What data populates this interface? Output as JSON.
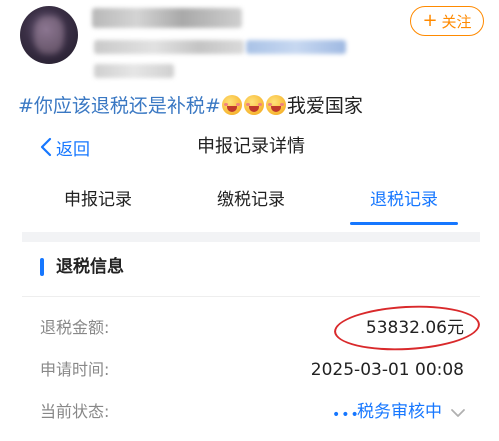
{
  "post": {
    "follow_label": "关注",
    "follow_icon": "plus-icon",
    "hashtag": "#你应该退税还是补税#",
    "emoji_name": "face-blowing-kiss-emoji",
    "emoji_count": 3,
    "tail_text": "我爱国家"
  },
  "screen": {
    "back_label": "返回",
    "title": "申报记录详情",
    "tabs": [
      {
        "label": "申报记录",
        "active": false
      },
      {
        "label": "缴税记录",
        "active": false
      },
      {
        "label": "退税记录",
        "active": true
      }
    ],
    "section_title": "退税信息",
    "rows": [
      {
        "label": "退税金额:",
        "value": "53832.06元"
      },
      {
        "label": "申请时间:",
        "value": "2025-03-01 00:08"
      },
      {
        "label": "当前状态:",
        "value": "税务审核中"
      }
    ],
    "colors": {
      "accent": "#1677ff",
      "follow": "#ff8a00",
      "hashtag": "#3a78c3",
      "annotation_circle": "#d9292b"
    }
  }
}
